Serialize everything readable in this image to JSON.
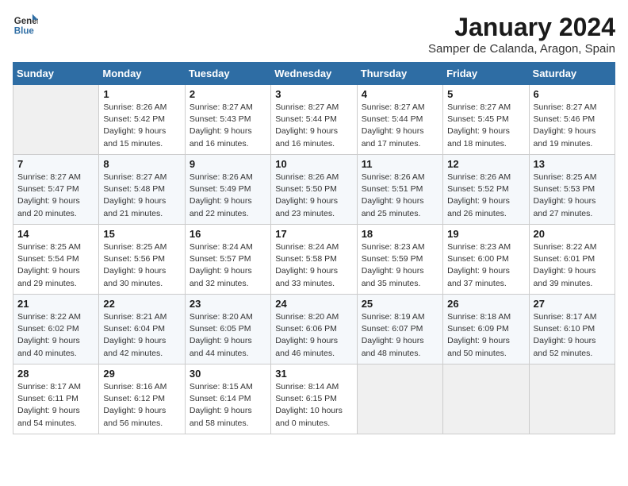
{
  "header": {
    "logo": {
      "line1": "General",
      "line2": "Blue"
    },
    "title": "January 2024",
    "location": "Samper de Calanda, Aragon, Spain"
  },
  "days_of_week": [
    "Sunday",
    "Monday",
    "Tuesday",
    "Wednesday",
    "Thursday",
    "Friday",
    "Saturday"
  ],
  "weeks": [
    [
      {
        "day": "",
        "sunrise": "",
        "sunset": "",
        "daylight": ""
      },
      {
        "day": "1",
        "sunrise": "Sunrise: 8:26 AM",
        "sunset": "Sunset: 5:42 PM",
        "daylight": "Daylight: 9 hours and 15 minutes."
      },
      {
        "day": "2",
        "sunrise": "Sunrise: 8:27 AM",
        "sunset": "Sunset: 5:43 PM",
        "daylight": "Daylight: 9 hours and 16 minutes."
      },
      {
        "day": "3",
        "sunrise": "Sunrise: 8:27 AM",
        "sunset": "Sunset: 5:44 PM",
        "daylight": "Daylight: 9 hours and 16 minutes."
      },
      {
        "day": "4",
        "sunrise": "Sunrise: 8:27 AM",
        "sunset": "Sunset: 5:44 PM",
        "daylight": "Daylight: 9 hours and 17 minutes."
      },
      {
        "day": "5",
        "sunrise": "Sunrise: 8:27 AM",
        "sunset": "Sunset: 5:45 PM",
        "daylight": "Daylight: 9 hours and 18 minutes."
      },
      {
        "day": "6",
        "sunrise": "Sunrise: 8:27 AM",
        "sunset": "Sunset: 5:46 PM",
        "daylight": "Daylight: 9 hours and 19 minutes."
      }
    ],
    [
      {
        "day": "7",
        "sunrise": "Sunrise: 8:27 AM",
        "sunset": "Sunset: 5:47 PM",
        "daylight": "Daylight: 9 hours and 20 minutes."
      },
      {
        "day": "8",
        "sunrise": "Sunrise: 8:27 AM",
        "sunset": "Sunset: 5:48 PM",
        "daylight": "Daylight: 9 hours and 21 minutes."
      },
      {
        "day": "9",
        "sunrise": "Sunrise: 8:26 AM",
        "sunset": "Sunset: 5:49 PM",
        "daylight": "Daylight: 9 hours and 22 minutes."
      },
      {
        "day": "10",
        "sunrise": "Sunrise: 8:26 AM",
        "sunset": "Sunset: 5:50 PM",
        "daylight": "Daylight: 9 hours and 23 minutes."
      },
      {
        "day": "11",
        "sunrise": "Sunrise: 8:26 AM",
        "sunset": "Sunset: 5:51 PM",
        "daylight": "Daylight: 9 hours and 25 minutes."
      },
      {
        "day": "12",
        "sunrise": "Sunrise: 8:26 AM",
        "sunset": "Sunset: 5:52 PM",
        "daylight": "Daylight: 9 hours and 26 minutes."
      },
      {
        "day": "13",
        "sunrise": "Sunrise: 8:25 AM",
        "sunset": "Sunset: 5:53 PM",
        "daylight": "Daylight: 9 hours and 27 minutes."
      }
    ],
    [
      {
        "day": "14",
        "sunrise": "Sunrise: 8:25 AM",
        "sunset": "Sunset: 5:54 PM",
        "daylight": "Daylight: 9 hours and 29 minutes."
      },
      {
        "day": "15",
        "sunrise": "Sunrise: 8:25 AM",
        "sunset": "Sunset: 5:56 PM",
        "daylight": "Daylight: 9 hours and 30 minutes."
      },
      {
        "day": "16",
        "sunrise": "Sunrise: 8:24 AM",
        "sunset": "Sunset: 5:57 PM",
        "daylight": "Daylight: 9 hours and 32 minutes."
      },
      {
        "day": "17",
        "sunrise": "Sunrise: 8:24 AM",
        "sunset": "Sunset: 5:58 PM",
        "daylight": "Daylight: 9 hours and 33 minutes."
      },
      {
        "day": "18",
        "sunrise": "Sunrise: 8:23 AM",
        "sunset": "Sunset: 5:59 PM",
        "daylight": "Daylight: 9 hours and 35 minutes."
      },
      {
        "day": "19",
        "sunrise": "Sunrise: 8:23 AM",
        "sunset": "Sunset: 6:00 PM",
        "daylight": "Daylight: 9 hours and 37 minutes."
      },
      {
        "day": "20",
        "sunrise": "Sunrise: 8:22 AM",
        "sunset": "Sunset: 6:01 PM",
        "daylight": "Daylight: 9 hours and 39 minutes."
      }
    ],
    [
      {
        "day": "21",
        "sunrise": "Sunrise: 8:22 AM",
        "sunset": "Sunset: 6:02 PM",
        "daylight": "Daylight: 9 hours and 40 minutes."
      },
      {
        "day": "22",
        "sunrise": "Sunrise: 8:21 AM",
        "sunset": "Sunset: 6:04 PM",
        "daylight": "Daylight: 9 hours and 42 minutes."
      },
      {
        "day": "23",
        "sunrise": "Sunrise: 8:20 AM",
        "sunset": "Sunset: 6:05 PM",
        "daylight": "Daylight: 9 hours and 44 minutes."
      },
      {
        "day": "24",
        "sunrise": "Sunrise: 8:20 AM",
        "sunset": "Sunset: 6:06 PM",
        "daylight": "Daylight: 9 hours and 46 minutes."
      },
      {
        "day": "25",
        "sunrise": "Sunrise: 8:19 AM",
        "sunset": "Sunset: 6:07 PM",
        "daylight": "Daylight: 9 hours and 48 minutes."
      },
      {
        "day": "26",
        "sunrise": "Sunrise: 8:18 AM",
        "sunset": "Sunset: 6:09 PM",
        "daylight": "Daylight: 9 hours and 50 minutes."
      },
      {
        "day": "27",
        "sunrise": "Sunrise: 8:17 AM",
        "sunset": "Sunset: 6:10 PM",
        "daylight": "Daylight: 9 hours and 52 minutes."
      }
    ],
    [
      {
        "day": "28",
        "sunrise": "Sunrise: 8:17 AM",
        "sunset": "Sunset: 6:11 PM",
        "daylight": "Daylight: 9 hours and 54 minutes."
      },
      {
        "day": "29",
        "sunrise": "Sunrise: 8:16 AM",
        "sunset": "Sunset: 6:12 PM",
        "daylight": "Daylight: 9 hours and 56 minutes."
      },
      {
        "day": "30",
        "sunrise": "Sunrise: 8:15 AM",
        "sunset": "Sunset: 6:14 PM",
        "daylight": "Daylight: 9 hours and 58 minutes."
      },
      {
        "day": "31",
        "sunrise": "Sunrise: 8:14 AM",
        "sunset": "Sunset: 6:15 PM",
        "daylight": "Daylight: 10 hours and 0 minutes."
      },
      {
        "day": "",
        "sunrise": "",
        "sunset": "",
        "daylight": ""
      },
      {
        "day": "",
        "sunrise": "",
        "sunset": "",
        "daylight": ""
      },
      {
        "day": "",
        "sunrise": "",
        "sunset": "",
        "daylight": ""
      }
    ]
  ]
}
